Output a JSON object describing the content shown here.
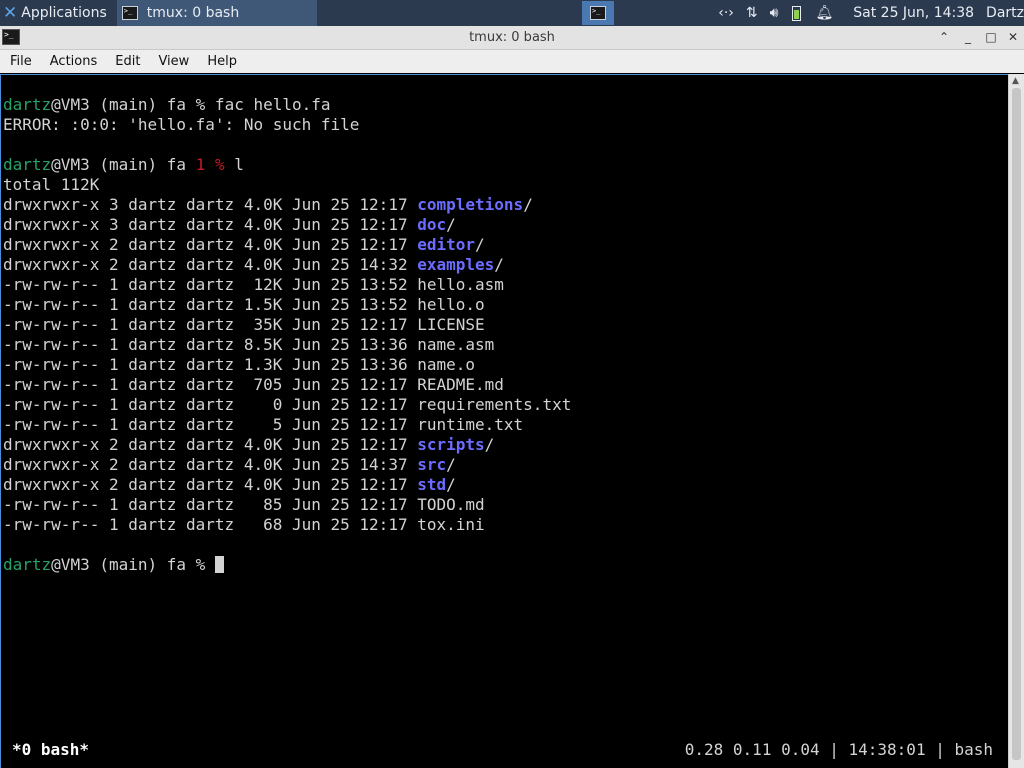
{
  "panel": {
    "apps_label": "Applications",
    "task_label": "tmux: 0 bash",
    "clock": "Sat 25 Jun, 14:38",
    "user": "Dartz",
    "tray_icons": [
      "network-icon",
      "transfer-icon",
      "volume-icon",
      "battery-icon",
      "notification-bell-icon"
    ]
  },
  "window": {
    "title": "tmux: 0 bash"
  },
  "menu": {
    "file": "File",
    "actions": "Actions",
    "edit": "Edit",
    "view": "View",
    "help": "Help"
  },
  "terminal": {
    "lines": [
      {
        "spans": [
          {
            "t": "dartz",
            "c": "green"
          },
          {
            "t": "@VM3 (main) fa % fac hello.fa"
          }
        ]
      },
      {
        "spans": [
          {
            "t": "ERROR: :0:0: 'hello.fa': No such file"
          }
        ]
      },
      {
        "spans": [
          {
            "t": ""
          }
        ]
      },
      {
        "spans": [
          {
            "t": "dartz",
            "c": "green"
          },
          {
            "t": "@VM3 (main) fa "
          },
          {
            "t": "1",
            "c": "red"
          },
          {
            "t": " "
          },
          {
            "t": "%",
            "c": "red"
          },
          {
            "t": " l"
          }
        ]
      },
      {
        "spans": [
          {
            "t": "total 112K"
          }
        ]
      },
      {
        "spans": [
          {
            "t": "drwxrwxr-x 3 dartz dartz 4.0K Jun 25 12:17 "
          },
          {
            "t": "completions",
            "c": "dir"
          },
          {
            "t": "/"
          }
        ]
      },
      {
        "spans": [
          {
            "t": "drwxrwxr-x 3 dartz dartz 4.0K Jun 25 12:17 "
          },
          {
            "t": "doc",
            "c": "dir"
          },
          {
            "t": "/"
          }
        ]
      },
      {
        "spans": [
          {
            "t": "drwxrwxr-x 2 dartz dartz 4.0K Jun 25 12:17 "
          },
          {
            "t": "editor",
            "c": "dir"
          },
          {
            "t": "/"
          }
        ]
      },
      {
        "spans": [
          {
            "t": "drwxrwxr-x 2 dartz dartz 4.0K Jun 25 14:32 "
          },
          {
            "t": "examples",
            "c": "dir"
          },
          {
            "t": "/"
          }
        ]
      },
      {
        "spans": [
          {
            "t": "-rw-rw-r-- 1 dartz dartz  12K Jun 25 13:52 hello.asm"
          }
        ]
      },
      {
        "spans": [
          {
            "t": "-rw-rw-r-- 1 dartz dartz 1.5K Jun 25 13:52 hello.o"
          }
        ]
      },
      {
        "spans": [
          {
            "t": "-rw-rw-r-- 1 dartz dartz  35K Jun 25 12:17 LICENSE"
          }
        ]
      },
      {
        "spans": [
          {
            "t": "-rw-rw-r-- 1 dartz dartz 8.5K Jun 25 13:36 name.asm"
          }
        ]
      },
      {
        "spans": [
          {
            "t": "-rw-rw-r-- 1 dartz dartz 1.3K Jun 25 13:36 name.o"
          }
        ]
      },
      {
        "spans": [
          {
            "t": "-rw-rw-r-- 1 dartz dartz  705 Jun 25 12:17 README.md"
          }
        ]
      },
      {
        "spans": [
          {
            "t": "-rw-rw-r-- 1 dartz dartz    0 Jun 25 12:17 requirements.txt"
          }
        ]
      },
      {
        "spans": [
          {
            "t": "-rw-rw-r-- 1 dartz dartz    5 Jun 25 12:17 runtime.txt"
          }
        ]
      },
      {
        "spans": [
          {
            "t": "drwxrwxr-x 2 dartz dartz 4.0K Jun 25 12:17 "
          },
          {
            "t": "scripts",
            "c": "dir"
          },
          {
            "t": "/"
          }
        ]
      },
      {
        "spans": [
          {
            "t": "drwxrwxr-x 2 dartz dartz 4.0K Jun 25 14:37 "
          },
          {
            "t": "src",
            "c": "dir"
          },
          {
            "t": "/"
          }
        ]
      },
      {
        "spans": [
          {
            "t": "drwxrwxr-x 2 dartz dartz 4.0K Jun 25 12:17 "
          },
          {
            "t": "std",
            "c": "dir"
          },
          {
            "t": "/"
          }
        ]
      },
      {
        "spans": [
          {
            "t": "-rw-rw-r-- 1 dartz dartz   85 Jun 25 12:17 TODO.md"
          }
        ]
      },
      {
        "spans": [
          {
            "t": "-rw-rw-r-- 1 dartz dartz   68 Jun 25 12:17 tox.ini"
          }
        ]
      },
      {
        "spans": [
          {
            "t": ""
          }
        ]
      },
      {
        "spans": [
          {
            "t": "dartz",
            "c": "green"
          },
          {
            "t": "@VM3 (main) fa % "
          }
        ],
        "cursor": true
      }
    ],
    "colors": {
      "green": "#26a269",
      "red": "#c01c28",
      "dir": "#6c6cff",
      "text": "#d3d3d3"
    }
  },
  "tmux_status": {
    "left": "*0 bash*",
    "right": "0.28 0.11 0.04 | 14:38:01 | bash"
  }
}
